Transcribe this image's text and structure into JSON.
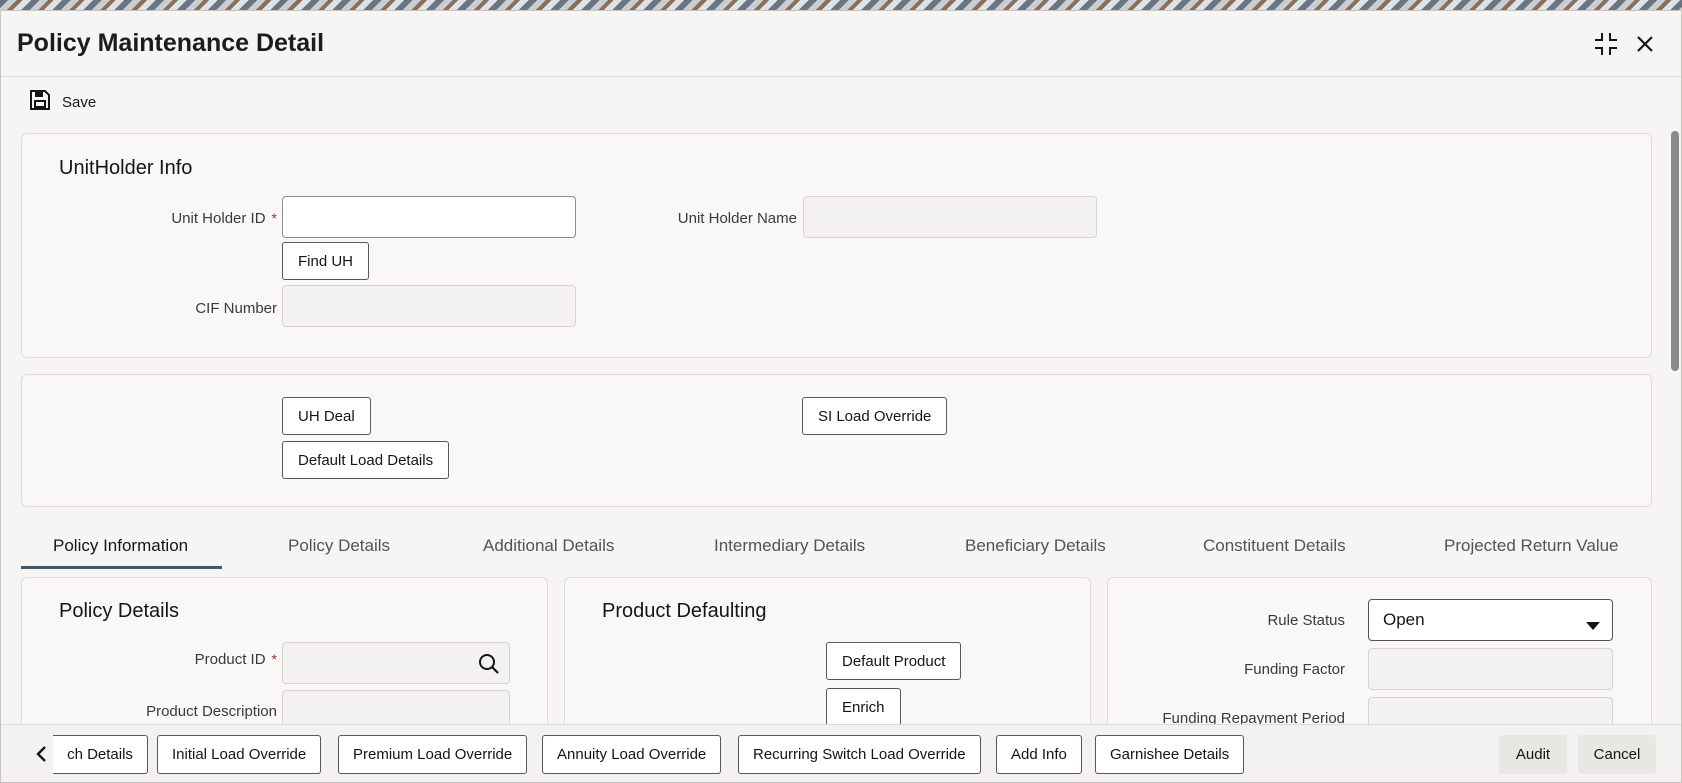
{
  "window": {
    "title": "Policy Maintenance Detail"
  },
  "toolbar": {
    "save_label": "Save"
  },
  "unitholder": {
    "title": "UnitHolder Info",
    "unit_holder_id_label": "Unit Holder ID",
    "required_mark": "*",
    "unit_holder_id_value": "",
    "unit_holder_name_label": "Unit Holder Name",
    "unit_holder_name_value": "",
    "find_uh_label": "Find UH",
    "cif_number_label": "CIF Number",
    "cif_number_value": ""
  },
  "actions": {
    "uh_deal_label": "UH Deal",
    "default_load_details_label": "Default Load Details",
    "si_load_override_label": "SI Load Override"
  },
  "tabs": [
    {
      "label": "Policy Information",
      "active": true
    },
    {
      "label": "Policy Details",
      "active": false
    },
    {
      "label": "Additional Details",
      "active": false
    },
    {
      "label": "Intermediary Details",
      "active": false
    },
    {
      "label": "Beneficiary Details",
      "active": false
    },
    {
      "label": "Constituent Details",
      "active": false
    },
    {
      "label": "Projected Return Value",
      "active": false
    }
  ],
  "policy_details": {
    "title": "Policy Details",
    "product_id_label": "Product ID",
    "product_id_value": "",
    "product_description_label": "Product Description",
    "product_description_value": ""
  },
  "product_defaulting": {
    "title": "Product Defaulting",
    "default_product_label": "Default Product",
    "enrich_label": "Enrich"
  },
  "rules": {
    "rule_status_label": "Rule Status",
    "rule_status_value": "Open",
    "funding_factor_label": "Funding Factor",
    "funding_factor_value": "",
    "funding_repayment_period_label": "Funding Repayment Period",
    "funding_repayment_period_value": ""
  },
  "footer": {
    "buttons": [
      "ch Details",
      "Initial Load Override",
      "Premium Load Override",
      "Annuity Load Override",
      "Recurring Switch Load Override",
      "Add Info",
      "Garnishee Details"
    ],
    "audit_label": "Audit",
    "cancel_label": "Cancel"
  },
  "icons": {
    "save": "save-icon",
    "maximize": "maximize-icon",
    "close": "close-icon",
    "search": "search-icon",
    "dropdown": "chevron-down-icon",
    "back": "chevron-left-icon"
  },
  "colors": {
    "tab_underline": "#3f5a6f",
    "required": "#8b3b2b"
  }
}
